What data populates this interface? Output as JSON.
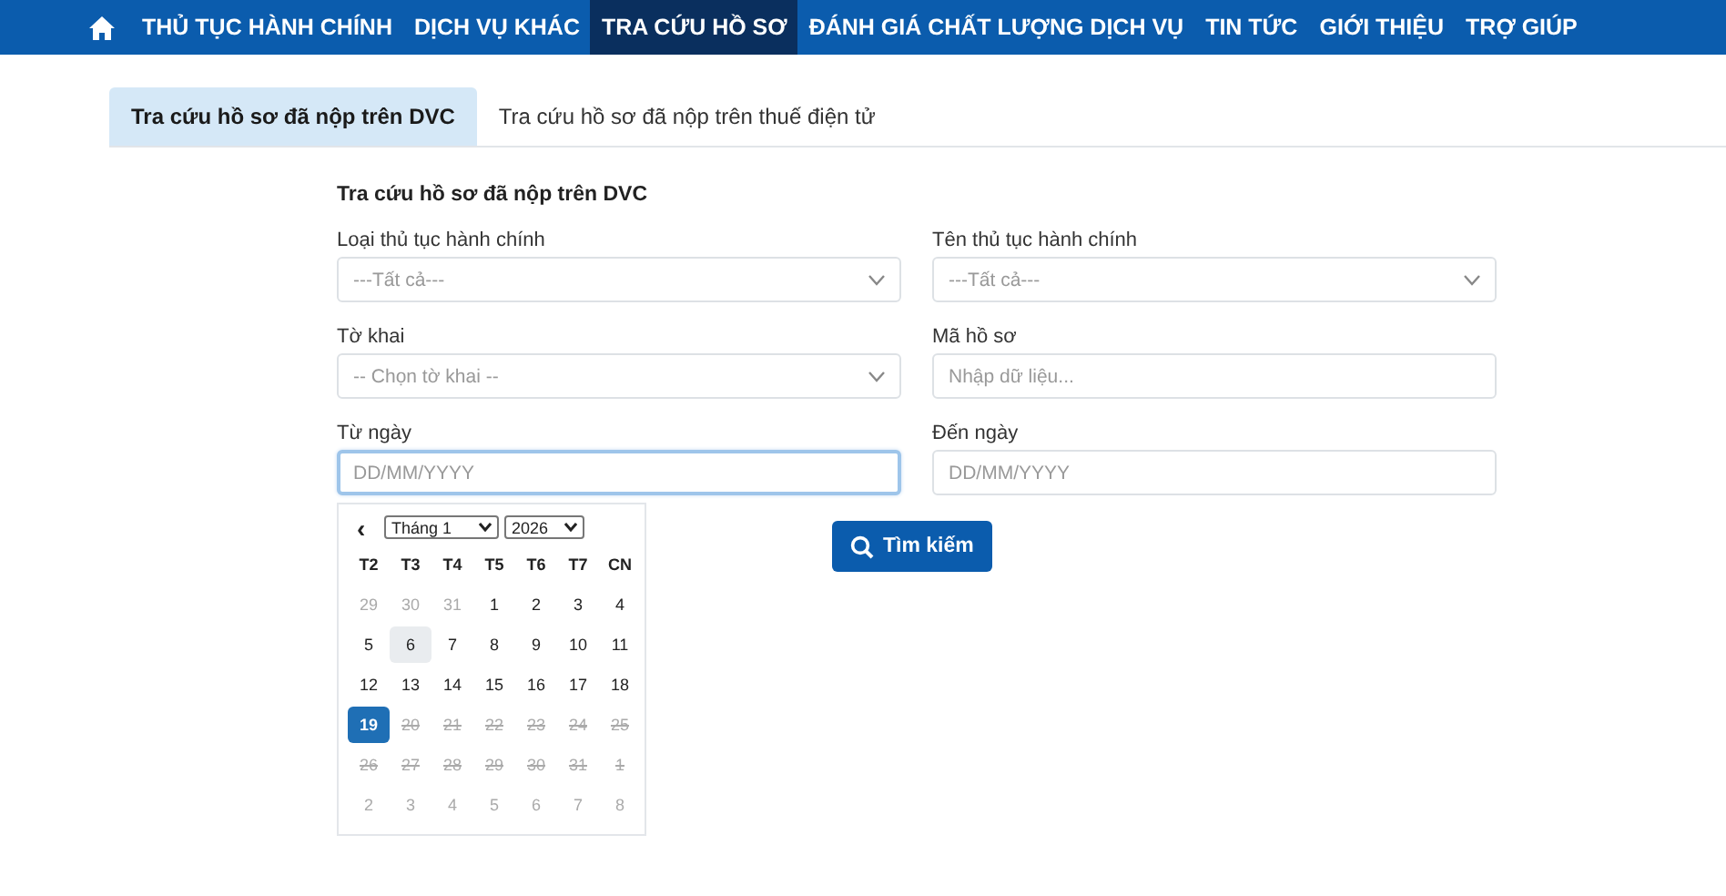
{
  "nav": {
    "items": [
      {
        "label": "THỦ TỤC HÀNH CHÍNH",
        "selected": false
      },
      {
        "label": "DỊCH VỤ KHÁC",
        "selected": false
      },
      {
        "label": "TRA CỨU HỒ SƠ",
        "selected": true
      },
      {
        "label": "ĐÁNH GIÁ CHẤT LƯỢNG DỊCH VỤ",
        "selected": false
      },
      {
        "label": "TIN TỨC",
        "selected": false
      },
      {
        "label": "GIỚI THIỆU",
        "selected": false
      },
      {
        "label": "TRỢ GIÚP",
        "selected": false
      }
    ]
  },
  "tabs": [
    {
      "label": "Tra cứu hồ sơ đã nộp trên DVC",
      "selected": true
    },
    {
      "label": "Tra cứu hồ sơ đã nộp trên thuế điện tử",
      "selected": false
    }
  ],
  "form": {
    "title": "Tra cứu hồ sơ đã nộp trên DVC",
    "fields": [
      {
        "label": "Loại thủ tục hành chính",
        "kind": "select",
        "value": "---Tất cả---",
        "focused": false
      },
      {
        "label": "Tên thủ tục hành chính",
        "kind": "select",
        "value": "---Tất cả---",
        "focused": false
      },
      {
        "label": "Tờ khai",
        "kind": "select",
        "value": "-- Chọn tờ khai --",
        "focused": false
      },
      {
        "label": "Mã hồ sơ",
        "kind": "text",
        "placeholder": "Nhập dữ liệu...",
        "focused": false
      },
      {
        "label": "Từ ngày",
        "kind": "text",
        "placeholder": "DD/MM/YYYY",
        "focused": true
      },
      {
        "label": "Đến ngày",
        "kind": "text",
        "placeholder": "DD/MM/YYYY",
        "focused": false
      }
    ],
    "search_button": "Tìm kiếm"
  },
  "calendar": {
    "prev": "‹",
    "month": "Tháng 1",
    "year": "2026",
    "weekdays": [
      "T2",
      "T3",
      "T4",
      "T5",
      "T6",
      "T7",
      "CN"
    ],
    "weeks": [
      [
        {
          "label": "29",
          "kind": "outside",
          "selected": false
        },
        {
          "label": "30",
          "kind": "outside",
          "selected": false
        },
        {
          "label": "31",
          "kind": "outside",
          "selected": false
        },
        {
          "label": "1",
          "kind": "normal",
          "selected": false
        },
        {
          "label": "2",
          "kind": "normal",
          "selected": false
        },
        {
          "label": "3",
          "kind": "normal",
          "selected": false
        },
        {
          "label": "4",
          "kind": "normal",
          "selected": false
        }
      ],
      [
        {
          "label": "5",
          "kind": "normal",
          "selected": false
        },
        {
          "label": "6",
          "kind": "hovered",
          "selected": false
        },
        {
          "label": "7",
          "kind": "normal",
          "selected": false
        },
        {
          "label": "8",
          "kind": "normal",
          "selected": false
        },
        {
          "label": "9",
          "kind": "normal",
          "selected": false
        },
        {
          "label": "10",
          "kind": "normal",
          "selected": false
        },
        {
          "label": "11",
          "kind": "normal",
          "selected": false
        }
      ],
      [
        {
          "label": "12",
          "kind": "normal",
          "selected": false
        },
        {
          "label": "13",
          "kind": "normal",
          "selected": false
        },
        {
          "label": "14",
          "kind": "normal",
          "selected": false
        },
        {
          "label": "15",
          "kind": "normal",
          "selected": false
        },
        {
          "label": "16",
          "kind": "normal",
          "selected": false
        },
        {
          "label": "17",
          "kind": "normal",
          "selected": false
        },
        {
          "label": "18",
          "kind": "normal",
          "selected": false
        }
      ],
      [
        {
          "label": "19",
          "kind": "normal",
          "selected": true
        },
        {
          "label": "20",
          "kind": "disabled",
          "selected": false
        },
        {
          "label": "21",
          "kind": "disabled",
          "selected": false
        },
        {
          "label": "22",
          "kind": "disabled",
          "selected": false
        },
        {
          "label": "23",
          "kind": "disabled",
          "selected": false
        },
        {
          "label": "24",
          "kind": "disabled",
          "selected": false
        },
        {
          "label": "25",
          "kind": "disabled",
          "selected": false
        }
      ],
      [
        {
          "label": "26",
          "kind": "disabled",
          "selected": false
        },
        {
          "label": "27",
          "kind": "disabled",
          "selected": false
        },
        {
          "label": "28",
          "kind": "disabled",
          "selected": false
        },
        {
          "label": "29",
          "kind": "disabled",
          "selected": false
        },
        {
          "label": "30",
          "kind": "disabled",
          "selected": false
        },
        {
          "label": "31",
          "kind": "disabled",
          "selected": false
        },
        {
          "label": "1",
          "kind": "disabled",
          "selected": false
        }
      ],
      [
        {
          "label": "2",
          "kind": "outside",
          "selected": false
        },
        {
          "label": "3",
          "kind": "outside",
          "selected": false
        },
        {
          "label": "4",
          "kind": "outside",
          "selected": false
        },
        {
          "label": "5",
          "kind": "outside",
          "selected": false
        },
        {
          "label": "6",
          "kind": "outside",
          "selected": false
        },
        {
          "label": "7",
          "kind": "outside",
          "selected": false
        },
        {
          "label": "8",
          "kind": "outside",
          "selected": false
        }
      ]
    ]
  }
}
